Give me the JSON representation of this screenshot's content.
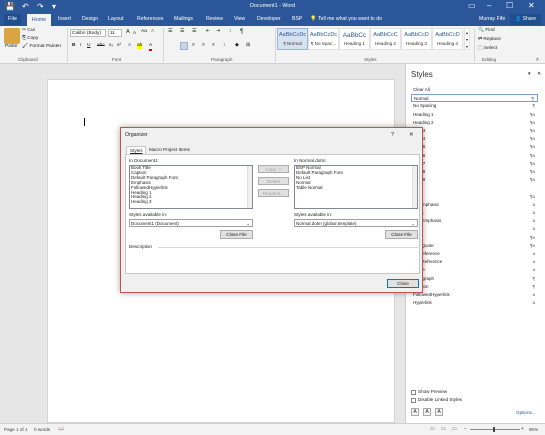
{
  "app": {
    "title": "Document1 - Word"
  },
  "window_controls": {
    "restore_ribbon": "▭",
    "minimize": "–",
    "maximize": "☐",
    "close": "✕"
  },
  "quick_access": {
    "save": "💾",
    "undo": "↶",
    "redo": "↷",
    "customize": "▾"
  },
  "tabs": [
    "Home",
    "Insert",
    "Design",
    "Layout",
    "References",
    "Mailings",
    "Review",
    "View",
    "Developer",
    "BSP"
  ],
  "file_tab": "File",
  "tell_me": "Tell me what you want to do",
  "user": "Murray Fife",
  "share": "Share",
  "clipboard": {
    "paste": "Paste",
    "cut": "Cut",
    "copy": "Copy",
    "format_painter": "Format Painter",
    "group_label": "Clipboard"
  },
  "font": {
    "name": "Calibri (Body)",
    "size": "11",
    "group_label": "Font",
    "bold": "B",
    "italic": "I",
    "underline": "U",
    "strike": "abc",
    "sub": "x₂",
    "sup": "x²",
    "grow": "A",
    "shrink": "A",
    "case": "Aa",
    "clear": "A",
    "effects": "A",
    "highlight": "ab",
    "color": "A"
  },
  "paragraph": {
    "group_label": "Paragraph",
    "pilcrow": "¶"
  },
  "styles_gallery": {
    "group_label": "Styles",
    "items": [
      {
        "preview": "AaBbCcDc",
        "name": "¶ Normal"
      },
      {
        "preview": "AaBbCcDc",
        "name": "¶ No Spac..."
      },
      {
        "preview": "AaBbCc",
        "name": "Heading 1"
      },
      {
        "preview": "AaBbCcC",
        "name": "Heading 2"
      },
      {
        "preview": "AaBbCcD",
        "name": "Heading 3"
      },
      {
        "preview": "AaBbCcD",
        "name": "Heading 4"
      }
    ]
  },
  "editing": {
    "find": "Find",
    "replace": "Replace",
    "select": "Select",
    "group_label": "Editing"
  },
  "styles_pane": {
    "title": "Styles",
    "close": "✕",
    "items": [
      {
        "name": "Clear All",
        "sym": ""
      },
      {
        "name": "Normal",
        "sym": "¶"
      },
      {
        "name": "No Spacing",
        "sym": "¶"
      },
      {
        "name": "Heading 1",
        "sym": "¶a"
      },
      {
        "name": "Heading 2",
        "sym": "¶a"
      },
      {
        "name": "ding 3",
        "sym": "¶a"
      },
      {
        "name": "ding 4",
        "sym": "¶a"
      },
      {
        "name": "ding 5",
        "sym": "¶a"
      },
      {
        "name": "ding 6",
        "sym": "¶a"
      },
      {
        "name": "ding 7",
        "sym": "¶a"
      },
      {
        "name": "ding 8",
        "sym": "¶a"
      },
      {
        "name": "ding 9",
        "sym": "¶a"
      },
      {
        "name": "",
        "sym": ""
      },
      {
        "name": "title",
        "sym": "¶a"
      },
      {
        "name": "tle Emphasis",
        "sym": "a"
      },
      {
        "name": "hasis",
        "sym": "a"
      },
      {
        "name": "nse Emphasis",
        "sym": "a"
      },
      {
        "name": "ng",
        "sym": "a"
      },
      {
        "name": "te",
        "sym": "¶a"
      },
      {
        "name": "nse Quote",
        "sym": "¶a"
      },
      {
        "name": "tle Reference",
        "sym": "a"
      },
      {
        "name": "nse Reference",
        "sym": "a"
      },
      {
        "name": "k Title",
        "sym": "a"
      },
      {
        "name": "Paragraph",
        "sym": "¶"
      },
      {
        "name": "Caption",
        "sym": "¶"
      },
      {
        "name": "FollowedHyperlink",
        "sym": "a"
      },
      {
        "name": "Hyperlink",
        "sym": "a"
      }
    ],
    "show_preview": "Show Preview",
    "disable_linked": "Disable Linked Styles",
    "options": "Options..."
  },
  "organizer": {
    "title": "Organizer",
    "help": "?",
    "close_x": "✕",
    "tab_styles": "Styles",
    "tab_macro": "Macro Project Items",
    "left_label": "In Document1:",
    "left_items": [
      "Book Title",
      "Caption",
      "Default Paragraph Font",
      "Emphasis",
      "FollowedHyperlink",
      "Heading 1",
      "Heading 2",
      "Heading 3"
    ],
    "right_label": "In Normal.dotm:",
    "right_items": [
      "BSP Normal",
      "Default Paragraph Font",
      "No List",
      "Normal",
      "Table Normal"
    ],
    "copy": "Copy ->",
    "delete": "Delete",
    "rename": "Rename...",
    "left_avail_label": "Styles available in:",
    "left_avail_value": "Document1 (Document)",
    "right_avail_label": "Styles available in:",
    "right_avail_value": "Normal.dotm (global template)",
    "close_file_left": "Close File",
    "close_file_right": "Close File",
    "description_label": "Description",
    "close": "Close"
  },
  "status": {
    "page": "Page 1 of 1",
    "words": "0 words",
    "zoom": "90%"
  }
}
